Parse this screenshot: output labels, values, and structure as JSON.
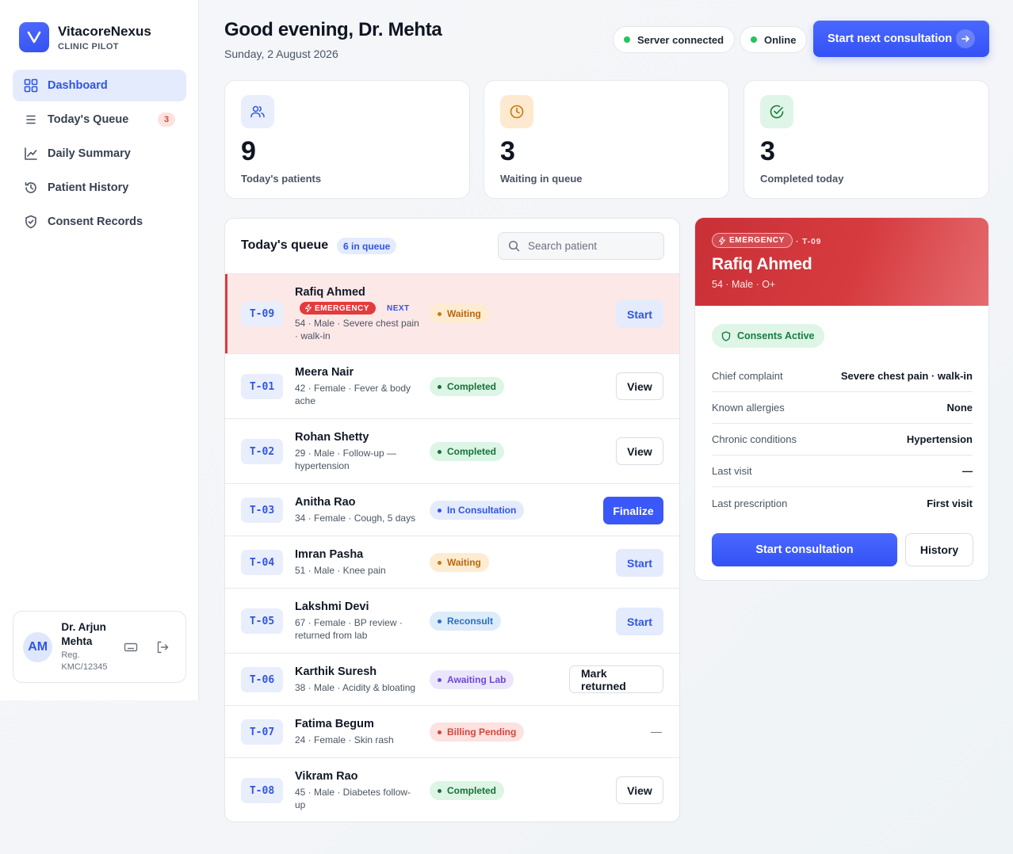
{
  "brand": {
    "name": "VitacoreNexus",
    "subtitle": "CLINIC PILOT",
    "logo_letter": "V"
  },
  "nav": {
    "items": [
      {
        "label": "Dashboard",
        "icon": "grid-icon",
        "active": true
      },
      {
        "label": "Today's Queue",
        "icon": "list-icon",
        "badge": "3"
      },
      {
        "label": "Daily Summary",
        "icon": "chart-icon"
      },
      {
        "label": "Patient History",
        "icon": "history-icon"
      },
      {
        "label": "Consent Records",
        "icon": "shield-icon"
      }
    ]
  },
  "user": {
    "initials": "AM",
    "name": "Dr. Arjun Mehta",
    "reg": "Reg. KMC/12345"
  },
  "header": {
    "greeting": "Good evening, Dr. Mehta",
    "date": "Sunday, 2 August 2026",
    "server_status": "Server connected",
    "online_status": "Online",
    "cta_label": "Start next consultation"
  },
  "stats": [
    {
      "value": "9",
      "label": "Today's patients",
      "icon": "users-icon",
      "bg": "#e9eefc",
      "color": "#2f55e6"
    },
    {
      "value": "3",
      "label": "Waiting in queue",
      "icon": "clock-icon",
      "bg": "#fde9cf",
      "color": "#c67a0c"
    },
    {
      "value": "3",
      "label": "Completed today",
      "icon": "check-circle-icon",
      "bg": "#dff5e7",
      "color": "#16803c"
    }
  ],
  "queue": {
    "title": "Today's queue",
    "count_label": "6 in queue",
    "search_placeholder": "Search patient",
    "rows": [
      {
        "token": "T-09",
        "name": "Rafiq Ahmed",
        "emergency_tag": "EMERGENCY",
        "next_tag": "NEXT",
        "meta": "54 · Male · Severe chest pain · walk-in",
        "status": "Waiting",
        "action": "Start",
        "kind": "emergency"
      },
      {
        "token": "T-01",
        "name": "Meera Nair",
        "meta": "42 · Female · Fever & body ache",
        "status": "Completed",
        "action": "View"
      },
      {
        "token": "T-02",
        "name": "Rohan Shetty",
        "meta": "29 · Male · Follow-up — hypertension",
        "status": "Completed",
        "action": "View"
      },
      {
        "token": "T-03",
        "name": "Anitha Rao",
        "meta": "34 · Female · Cough, 5 days",
        "status": "In Consultation",
        "action": "Finalize"
      },
      {
        "token": "T-04",
        "name": "Imran Pasha",
        "meta": "51 · Male · Knee pain",
        "status": "Waiting",
        "action": "Start"
      },
      {
        "token": "T-05",
        "name": "Lakshmi Devi",
        "meta": "67 · Female · BP review · returned from lab",
        "status": "Reconsult",
        "action": "Start"
      },
      {
        "token": "T-06",
        "name": "Karthik Suresh",
        "meta": "38 · Male · Acidity & bloating",
        "status": "Awaiting Lab",
        "action": "Mark returned"
      },
      {
        "token": "T-07",
        "name": "Fatima Begum",
        "meta": "24 · Female · Skin rash",
        "status": "Billing Pending",
        "action": "—"
      },
      {
        "token": "T-08",
        "name": "Vikram Rao",
        "meta": "45 · Male · Diabetes follow-up",
        "status": "Completed",
        "action": "View"
      }
    ]
  },
  "status_colors": {
    "Waiting": {
      "bg": "#fdecd2",
      "fg": "#b8690a",
      "dot": "#c77a12"
    },
    "Completed": {
      "bg": "#dcf5e5",
      "fg": "#17703a",
      "dot": "#17703a"
    },
    "In Consultation": {
      "bg": "#e4ebfd",
      "fg": "#2f55e6",
      "dot": "#2f55e6"
    },
    "Reconsult": {
      "bg": "#dcecfb",
      "fg": "#2a6fbf",
      "dot": "#2a6fbf"
    },
    "Awaiting Lab": {
      "bg": "#ece6fc",
      "fg": "#6b4bd6",
      "dot": "#6b4bd6"
    },
    "Billing Pending": {
      "bg": "#fde2e0",
      "fg": "#d4453c",
      "dot": "#d4453c"
    }
  },
  "detail": {
    "tag": "EMERGENCY",
    "token": "· T-09",
    "name": "Rafiq Ahmed",
    "sub": "54 · Male · O+",
    "consent": "Consents Active",
    "fields": [
      {
        "key": "Chief complaint",
        "value": "Severe chest pain · walk-in"
      },
      {
        "key": "Known allergies",
        "value": "None"
      },
      {
        "key": "Chronic conditions",
        "value": "Hypertension"
      },
      {
        "key": "Last visit",
        "value": "—"
      },
      {
        "key": "Last prescription",
        "value": "First visit"
      }
    ],
    "primary_label": "Start consultation",
    "secondary_label": "History"
  }
}
